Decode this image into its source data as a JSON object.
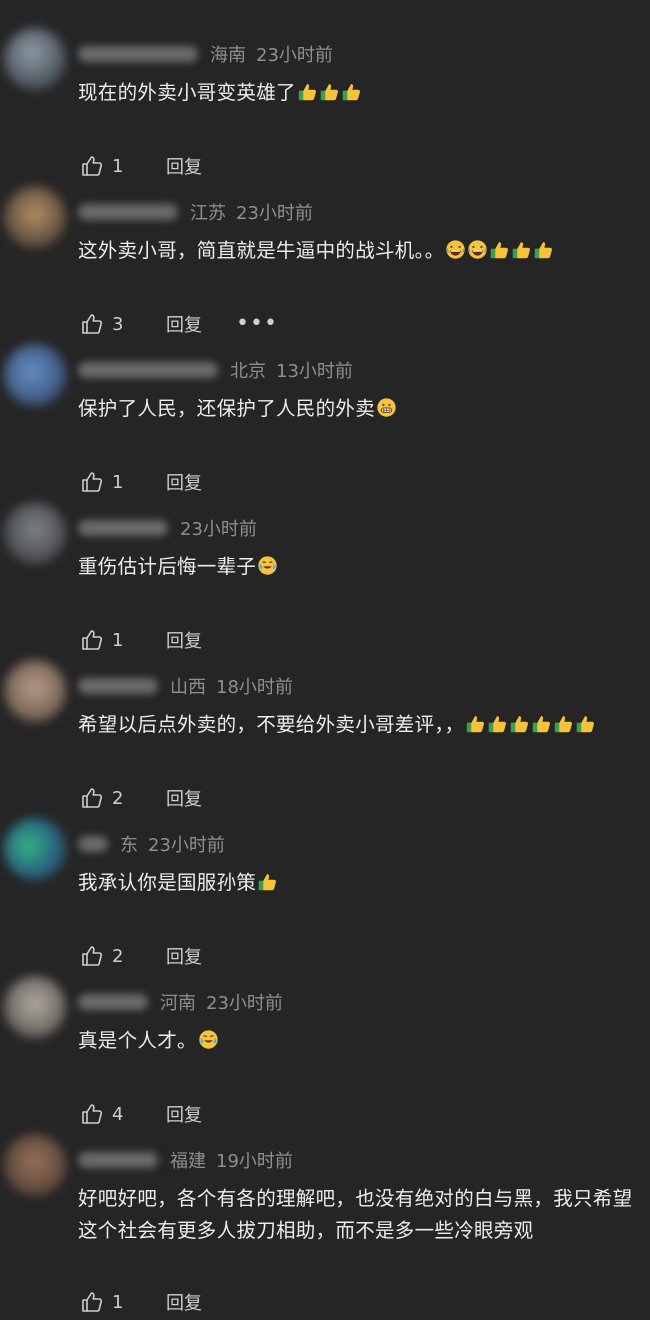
{
  "colors": {
    "background": "#252525",
    "text": "#ededed",
    "meta": "#8f8f8f",
    "action": "#cfcfcf"
  },
  "comments": [
    {
      "location": "海南",
      "time": "23小时前",
      "text": "现在的外卖小哥变英雄了",
      "emojis": [
        "thumbs-up",
        "thumbs-up",
        "thumbs-up"
      ],
      "likes": "1",
      "reply_label": "回复",
      "more": false
    },
    {
      "location": "江苏",
      "time": "23小时前",
      "text": "这外卖小哥，简直就是牛逼中的战斗机。。",
      "emojis": [
        "laughing",
        "laughing",
        "thumbs-up",
        "thumbs-up",
        "thumbs-up"
      ],
      "likes": "3",
      "reply_label": "回复",
      "more": true,
      "more_label": "•••"
    },
    {
      "location": "北京",
      "time": "13小时前",
      "text": "保护了人民，还保护了人民的外卖",
      "emojis": [
        "grinning"
      ],
      "likes": "1",
      "reply_label": "回复",
      "more": false
    },
    {
      "location": "",
      "time": "23小时前",
      "text": "重伤估计后悔一辈子",
      "emojis": [
        "crying-laugh"
      ],
      "likes": "1",
      "reply_label": "回复",
      "more": false
    },
    {
      "location": "山西",
      "time": "18小时前",
      "text": "希望以后点外卖的，不要给外卖小哥差评，，",
      "emojis": [
        "thumbs-up",
        "thumbs-up",
        "thumbs-up",
        "thumbs-up",
        "thumbs-up",
        "thumbs-up"
      ],
      "likes": "2",
      "reply_label": "回复",
      "more": false
    },
    {
      "location": "东",
      "time": "23小时前",
      "text": "我承认你是国服孙策",
      "emojis": [
        "thumbs-up"
      ],
      "likes": "2",
      "reply_label": "回复",
      "more": false
    },
    {
      "location": "河南",
      "time": "23小时前",
      "text": "真是个人才。",
      "emojis": [
        "crying-laugh"
      ],
      "likes": "4",
      "reply_label": "回复",
      "more": false
    },
    {
      "location": "福建",
      "time": "19小时前",
      "text": "好吧好吧，各个有各的理解吧，也没有绝对的白与黑，我只希望这个社会有更多人拔刀相助，而不是多一些冷眼旁观",
      "emojis": [],
      "likes": "1",
      "reply_label": "回复",
      "more": false
    }
  ]
}
